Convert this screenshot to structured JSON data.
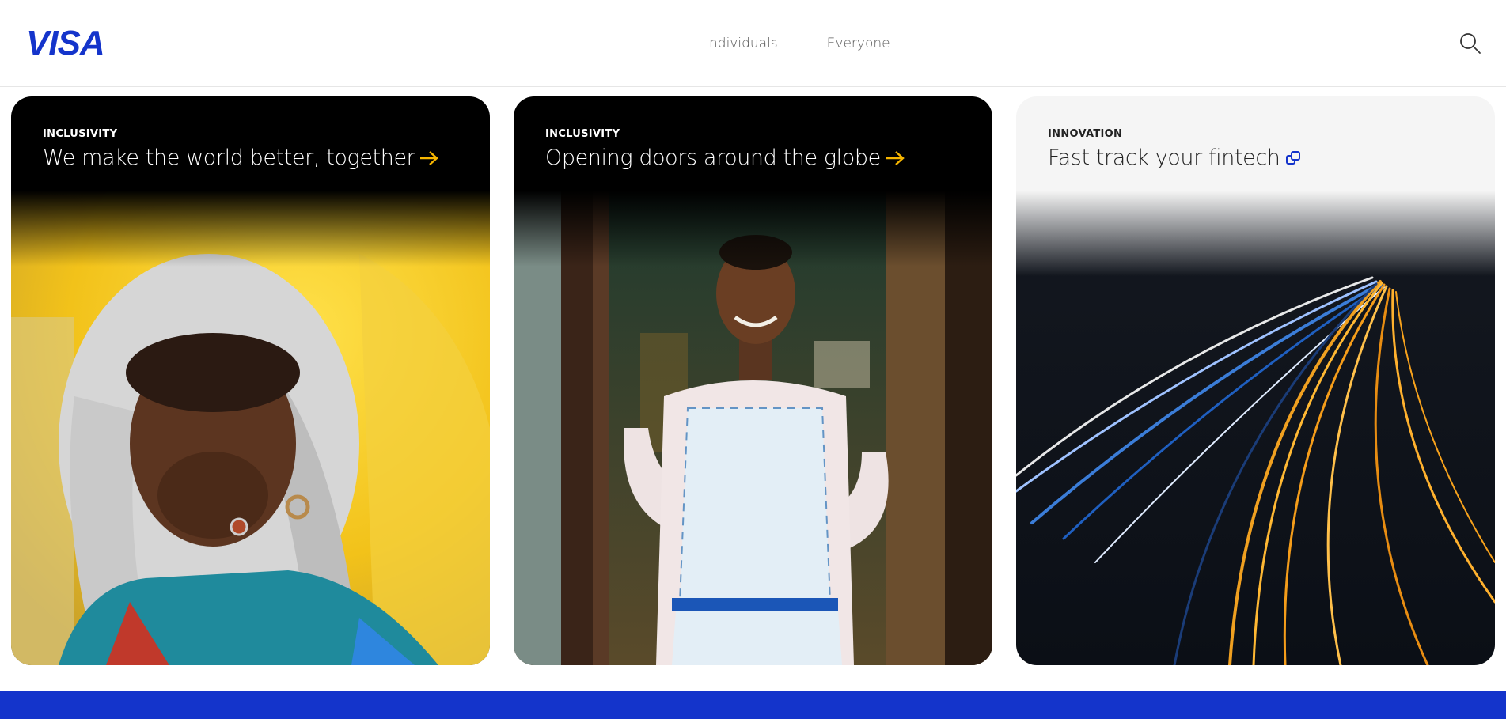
{
  "header": {
    "logo_text": "VISA",
    "nav": [
      {
        "label": "Individuals"
      },
      {
        "label": "Everyone"
      }
    ],
    "search_icon": "search-icon"
  },
  "cards": [
    {
      "eyebrow": "INCLUSIVITY",
      "title": "We make the world better, together",
      "icon": "arrow-right-icon",
      "theme": "dark",
      "accent": "#F7B600"
    },
    {
      "eyebrow": "INCLUSIVITY",
      "title": "Opening doors around the globe",
      "icon": "arrow-right-icon",
      "theme": "dark",
      "accent": "#F7B600"
    },
    {
      "eyebrow": "INNOVATION",
      "title": "Fast track your fintech",
      "icon": "external-link-icon",
      "theme": "light",
      "accent": "#1434CB"
    }
  ],
  "colors": {
    "brand_blue": "#1434CB",
    "arrow_gold": "#F7B600",
    "text_muted": "#5b5b5b"
  }
}
